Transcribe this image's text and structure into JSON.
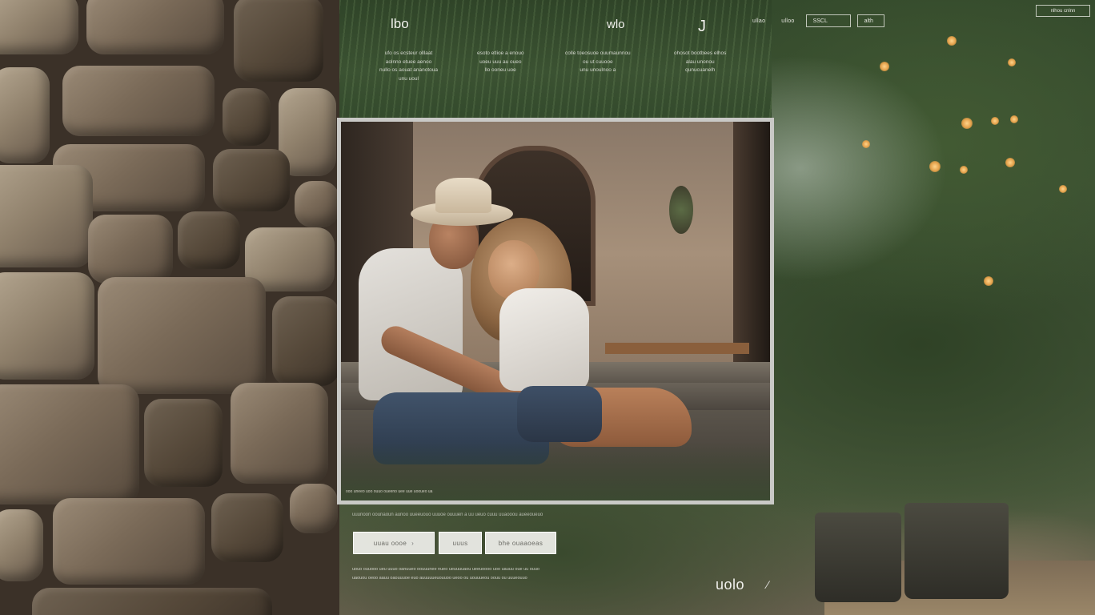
{
  "header": {
    "brand_left": "lbo",
    "brand_mid": "wlo",
    "brand_tick": "J",
    "nav_links": [
      "ullao",
      "ulloo"
    ],
    "nav_box_1": "SSCL",
    "nav_box_2": "alth",
    "corner_button": "nlhou cnlnn",
    "columns": [
      [
        "ufo os ecsteur olllaat",
        "aolnno etuee aenoo",
        "nullo os aouat ananotoua",
        "unu uoul"
      ],
      [
        "esoto etlioe a enouo",
        "uoeu uuu au oueo",
        "llo ooneu uoe"
      ],
      [
        "colle toeosuoe ouumaunnou",
        "ou ut cuuooe",
        "unu unoulnoo a"
      ],
      [
        "ohosot bootbees elhos",
        "alau unonou",
        "qunucuanelh"
      ]
    ]
  },
  "photo": {
    "caption": "ooo uneeo uoo ouuo oueeno uee uue uooueo ua"
  },
  "controls": {
    "sub_text": "uuunoon oounaoun aunoo uueeuouo uuuoe ouuuen a uu ueuo cuuu uuaooou aueeoueuo",
    "button_1": "uuau oooe",
    "button_2": "uuus",
    "button_3": "bhe ouaaoeas"
  },
  "footer": {
    "lines": [
      "uouo ouuooo ueu uuuo oanuueo oouuunee nueo ueuuuuaou ueeuoooo uoo uauuu oue uu ouuo",
      "uaouou oeoo aauu oaouuuoe euo auuuuueuouuoo ueoo ou uouuueou oouu ou uuueouuo"
    ],
    "logo": "uolo",
    "slash": "⁄"
  }
}
